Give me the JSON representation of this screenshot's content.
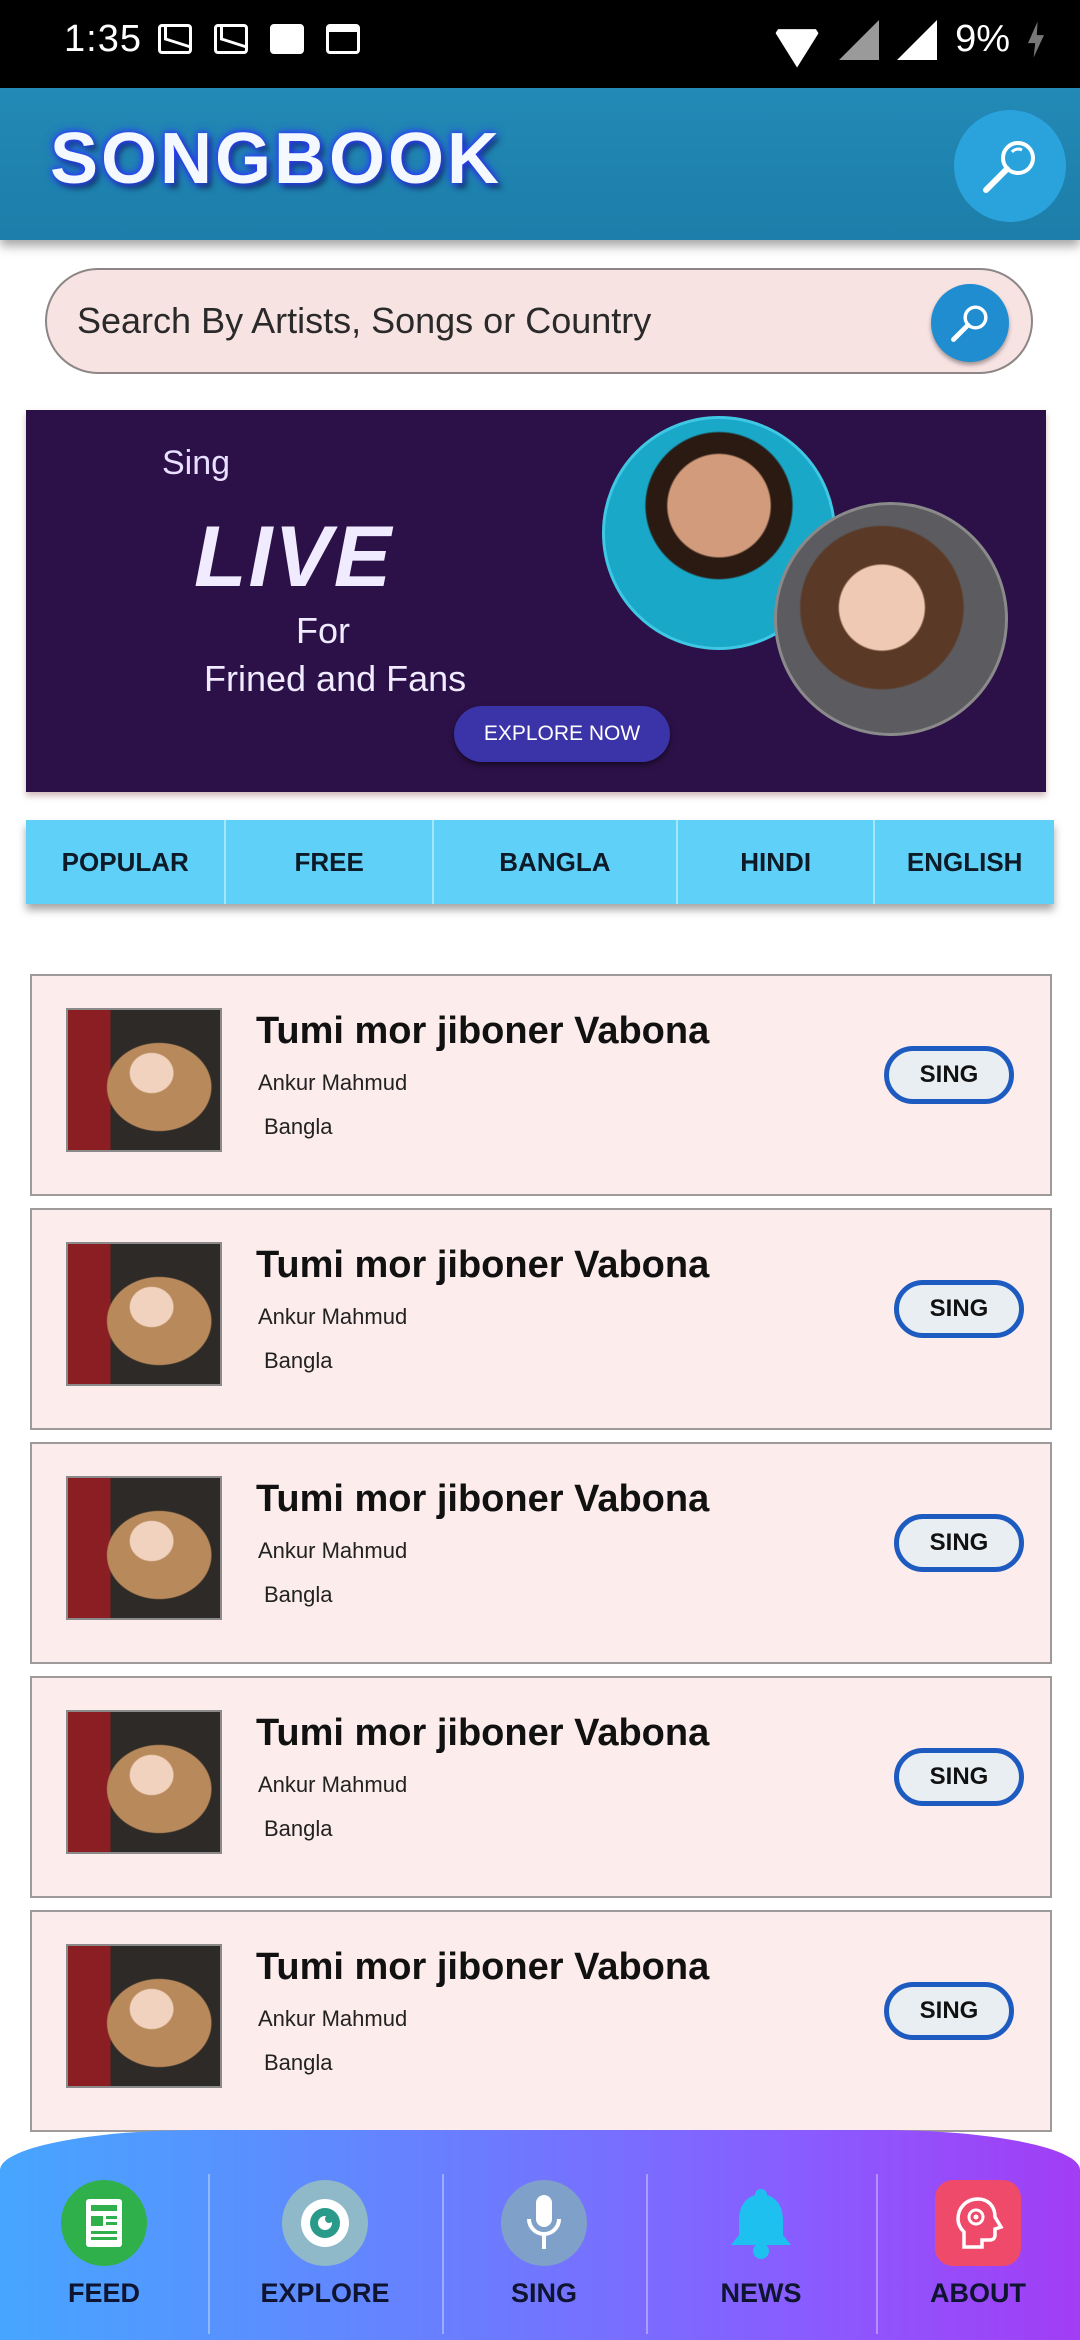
{
  "status_bar": {
    "time": "1:35",
    "battery": "9%"
  },
  "app": {
    "title": "SONGBOOK"
  },
  "search": {
    "placeholder": "Search By Artists, Songs or Country"
  },
  "banner": {
    "line1": "Sing",
    "line2": "LIVE",
    "line3": "For",
    "line4": "Frined and Fans",
    "button": "EXPLORE NOW"
  },
  "tabs": [
    "POPULAR",
    "FREE",
    "BANGLA",
    "HINDI",
    "ENGLISH"
  ],
  "songs": [
    {
      "title": "Tumi mor jiboner Vabona",
      "artist": "Ankur Mahmud",
      "language": "Bangla",
      "button": "SING"
    },
    {
      "title": "Tumi mor jiboner Vabona",
      "artist": "Ankur Mahmud",
      "language": "Bangla",
      "button": "SING"
    },
    {
      "title": "Tumi mor jiboner Vabona",
      "artist": "Ankur Mahmud",
      "language": "Bangla",
      "button": "SING"
    },
    {
      "title": "Tumi mor jiboner Vabona",
      "artist": "Ankur Mahmud",
      "language": "Bangla",
      "button": "SING"
    },
    {
      "title": "Tumi mor jiboner Vabona",
      "artist": "Ankur Mahmud",
      "language": "Bangla",
      "button": "SING"
    }
  ],
  "bottom_nav": [
    {
      "label": "FEED",
      "icon": "feed-icon",
      "color": "#2fb04a"
    },
    {
      "label": "EXPLORE",
      "icon": "eye-icon",
      "color": "#8fb8c8"
    },
    {
      "label": "SING",
      "icon": "microphone-icon",
      "color": "#7fa0c8"
    },
    {
      "label": "NEWS",
      "icon": "bell-icon",
      "color": "#1ec0f0"
    },
    {
      "label": "ABOUT",
      "icon": "head-gear-icon",
      "color": "#f04a6a"
    }
  ]
}
